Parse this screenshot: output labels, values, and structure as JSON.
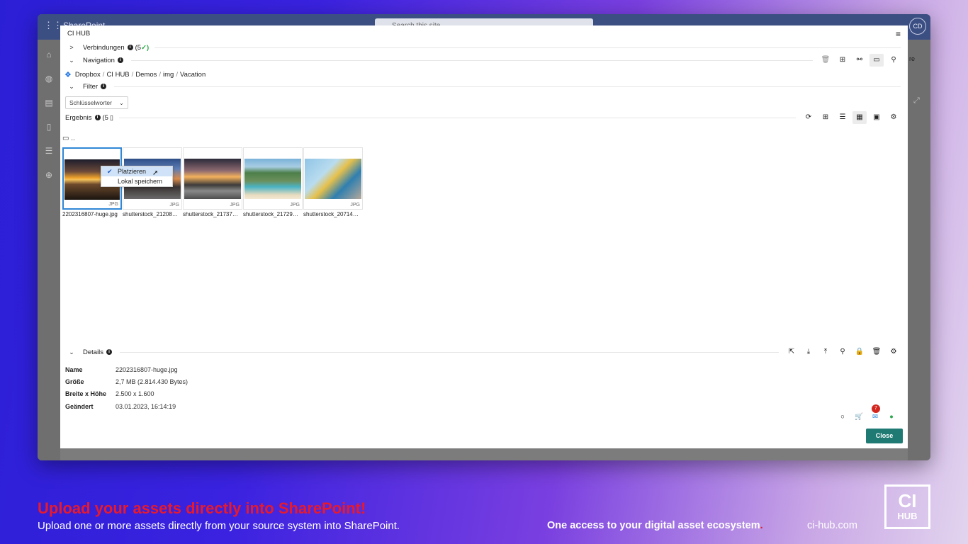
{
  "sharepoint": {
    "brand": "SharePoint",
    "search_placeholder": "Search this site",
    "avatar": "CD",
    "peek_label": "re"
  },
  "panel": {
    "title": "CI HUB",
    "sections": {
      "connections": {
        "label": "Verbindungen",
        "count": "(5",
        "check": "✓)"
      },
      "navigation": {
        "label": "Navigation"
      },
      "filter": {
        "label": "Filter"
      },
      "results": {
        "label": "Ergebnis",
        "count": "(5"
      },
      "details": {
        "label": "Details"
      }
    },
    "breadcrumb": [
      "Dropbox",
      "CI HUB",
      "Demos",
      "img",
      "Vacation"
    ],
    "filter_select": {
      "value": "Schlüsselworter"
    },
    "folder_up": "..",
    "thumbnails": [
      {
        "name": "2202316807-huge.jpg",
        "type": "JPG",
        "img": "sunset1",
        "selected": true
      },
      {
        "name": "shutterstock_21208…",
        "type": "JPG",
        "img": "sunset2",
        "selected": false
      },
      {
        "name": "shutterstock_21737…",
        "type": "JPG",
        "img": "sunset3",
        "selected": false
      },
      {
        "name": "shutterstock_21729…",
        "type": "JPG",
        "img": "beach",
        "selected": false
      },
      {
        "name": "shutterstock_20714…",
        "type": "JPG",
        "img": "woman",
        "selected": false
      }
    ],
    "context_menu": {
      "items": [
        {
          "label": "Platzieren",
          "checked": true,
          "highlighted": true
        },
        {
          "label": "Lokal speichern",
          "checked": false,
          "highlighted": false
        }
      ]
    },
    "details": [
      {
        "key": "Name",
        "value": "2202316807-huge.jpg"
      },
      {
        "key": "Größe",
        "value": "2,7 MB (2.814.430 Bytes)"
      },
      {
        "key": "Breite x Höhe",
        "value": "2.500 x 1.600"
      },
      {
        "key": "Geändert",
        "value": "03.01.2023, 16:14:19"
      }
    ],
    "notification_count": "7",
    "close_label": "Close"
  },
  "promo": {
    "headline": "Upload your assets directly into SharePoint!",
    "subtext": "Upload one or more assets directly from your source system into SharePoint.",
    "tagline": "One access to your digital asset ecosystem",
    "tagline_dot": ".",
    "site": "ci-hub.com",
    "logo_top": "CI",
    "logo_bottom": "HUB"
  },
  "colors": {
    "close_button": "#1f7a74",
    "headline": "#e8192c",
    "selection": "#2f87d6",
    "badge": "#d3261e"
  }
}
